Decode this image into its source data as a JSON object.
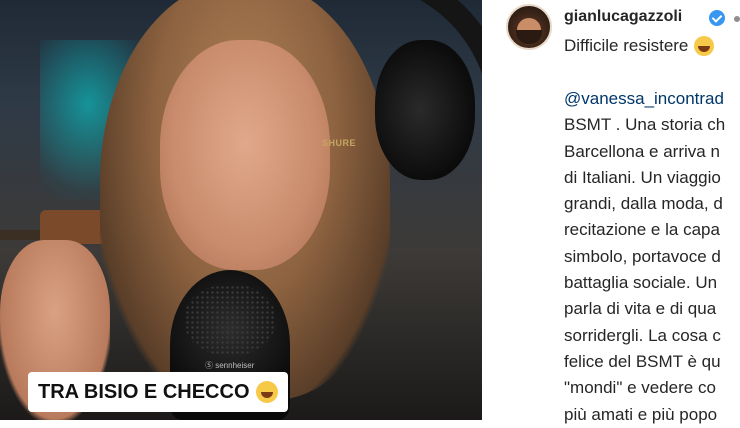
{
  "video": {
    "caption": "TRA BISIO E CHECCO",
    "caption_emoji": "grinning-squinting-face-icon",
    "mic_label": "Ⓢ sennheiser",
    "headphone_brand": "SHURE"
  },
  "post": {
    "username": "gianlucagazzoli",
    "verified_icon": "verified-badge-icon",
    "caption": "Difficile resistere",
    "caption_emoji": "grinning-squinting-face-icon",
    "mention": "@vanessa_incontrad",
    "body_lines": [
      "BSMT . Una storia ch",
      "Barcellona e arriva n",
      "di Italiani. Un viaggio",
      "grandi, dalla moda, d",
      "recitazione e la capa",
      "simbolo, portavoce d",
      "battaglia sociale. Un",
      "parla di vita e di qua",
      "sorridergli. La cosa c",
      "felice del BSMT è qu",
      "\"mondi\" e vedere co",
      "più amati e più popo"
    ]
  },
  "colors": {
    "text": "#262626",
    "mention": "#00376b",
    "verified": "#3897f0",
    "divider": "#dbdbdb"
  }
}
